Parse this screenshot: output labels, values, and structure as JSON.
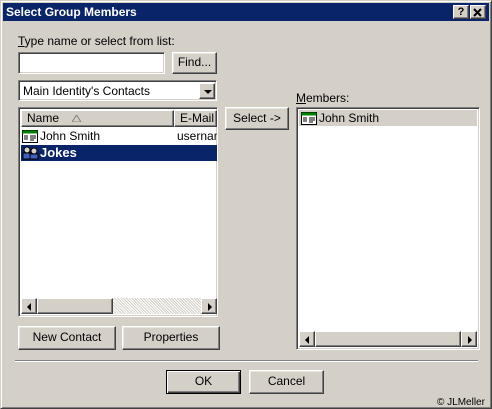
{
  "window": {
    "title": "Select Group Members",
    "help_label": "?",
    "close_label": "X"
  },
  "search": {
    "label": "Type name or select from list:",
    "value": "",
    "find_label": "Find..."
  },
  "folder": {
    "selected": "Main Identity's Contacts"
  },
  "contacts": {
    "columns": [
      "Name",
      "E-Mail A"
    ],
    "rows": [
      {
        "name": "John Smith",
        "email": "usernam",
        "icon": "contact-card-icon",
        "selected": false
      },
      {
        "name": "Jokes",
        "email": "",
        "icon": "group-icon",
        "selected": true
      }
    ]
  },
  "select_label": "Select ->",
  "members": {
    "label": "Members:",
    "items": [
      {
        "name": "John Smith",
        "icon": "contact-card-icon"
      }
    ]
  },
  "buttons": {
    "new_contact": "New Contact",
    "properties": "Properties",
    "ok": "OK",
    "cancel": "Cancel"
  },
  "watermark": "© JLMeller",
  "colors": {
    "titlebar": "#0a246a",
    "selection": "#0a246a",
    "face": "#d4d0c8"
  }
}
